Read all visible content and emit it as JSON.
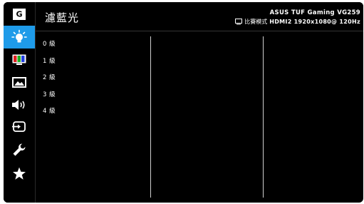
{
  "header": {
    "title": "濾藍光",
    "model": "ASUS TUF Gaming  VG259",
    "mode": "比賽模式",
    "signal": "HDMI2 1920x1080@ 120Hz"
  },
  "sidebar": {
    "items": [
      {
        "name": "gamevisual-icon",
        "label": "G",
        "active": false
      },
      {
        "name": "blue-light-filter-icon",
        "active": true
      },
      {
        "name": "color-icon",
        "active": false
      },
      {
        "name": "image-icon",
        "active": false
      },
      {
        "name": "sound-icon",
        "active": false
      },
      {
        "name": "input-select-icon",
        "active": false
      },
      {
        "name": "system-setup-icon",
        "active": false
      },
      {
        "name": "myfavorite-icon",
        "active": false
      }
    ]
  },
  "options": [
    {
      "label": "0 級"
    },
    {
      "label": "1 級"
    },
    {
      "label": "2 級"
    },
    {
      "label": "3 級"
    },
    {
      "label": "4 級"
    }
  ],
  "colors": {
    "accent": "#1e9be9",
    "background": "#000000",
    "text": "#ffffff"
  }
}
